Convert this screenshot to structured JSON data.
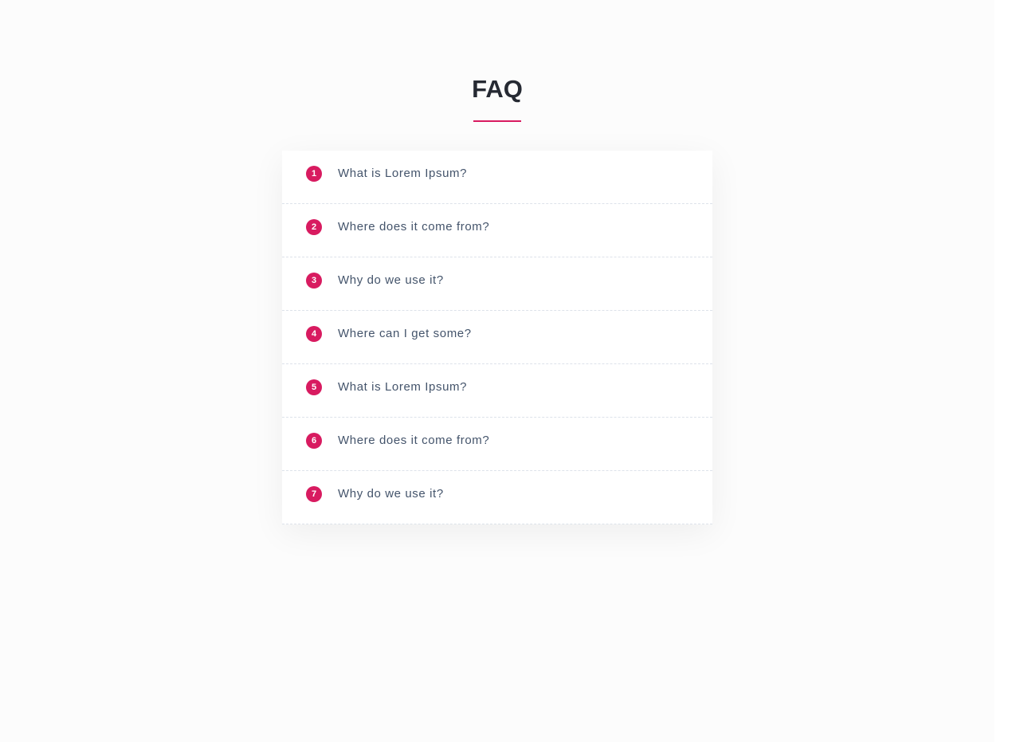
{
  "page": {
    "title": "FAQ",
    "accent_color": "#d81b60"
  },
  "faq": {
    "items": [
      {
        "number": "1",
        "question": "What is Lorem Ipsum?"
      },
      {
        "number": "2",
        "question": "Where does it come from?"
      },
      {
        "number": "3",
        "question": "Why do we use it?"
      },
      {
        "number": "4",
        "question": "Where can I get some?"
      },
      {
        "number": "5",
        "question": "What is Lorem Ipsum?"
      },
      {
        "number": "6",
        "question": "Where does it come from?"
      },
      {
        "number": "7",
        "question": "Why do we use it?"
      }
    ]
  }
}
